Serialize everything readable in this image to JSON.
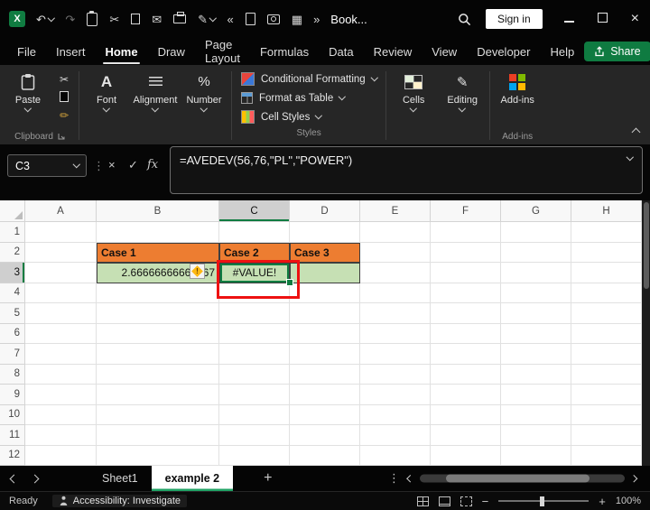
{
  "colors": {
    "accent_green": "#107C41",
    "share_green": "#0F7B41",
    "header_orange": "#ED7D31",
    "cell_green": "#C6E0B4",
    "annotation_red": "#EE1111",
    "active_sheet_underline": "#21A366"
  },
  "titlebar": {
    "logo_letter": "X",
    "title": "Book...",
    "sign_in_label": "Sign in",
    "overflow_glyph": "»",
    "close_glyph": "×",
    "quick_access": [
      {
        "name": "undo",
        "glyph": "↶",
        "caret": true
      },
      {
        "name": "redo",
        "glyph": "↷",
        "dim": true
      },
      {
        "name": "clipboard",
        "css": "clipboard"
      },
      {
        "name": "cut",
        "glyph": "✂"
      },
      {
        "name": "copy",
        "css": "copy"
      },
      {
        "name": "mail",
        "glyph": "✉"
      },
      {
        "name": "printer",
        "css": "printer"
      },
      {
        "name": "pen",
        "glyph": "✎",
        "caret": true
      },
      {
        "name": "collapse-toolbar",
        "glyph": "«"
      },
      {
        "name": "document",
        "css": "document"
      },
      {
        "name": "camera",
        "css": "camera"
      },
      {
        "name": "grid-view",
        "glyph": "▦"
      }
    ]
  },
  "menubar": {
    "tabs": [
      "File",
      "Insert",
      "Home",
      "Draw",
      "Page Layout",
      "Formulas",
      "Data",
      "Review",
      "View",
      "Developer",
      "Help"
    ],
    "active": "Home",
    "share_label": "Share"
  },
  "ribbon": {
    "paste_label": "Paste",
    "clipboard_group_label": "Clipboard",
    "font_label": "Font",
    "font_icon_letter": "A",
    "alignment_label": "Alignment",
    "number_label": "Number",
    "number_icon_glyph": "%",
    "styles_items": [
      "Conditional Formatting",
      "Format as Table",
      "Cell Styles"
    ],
    "styles_group_label": "Styles",
    "cells_label": "Cells",
    "editing_label": "Editing",
    "editing_icon_glyph": "✎",
    "addins_label": "Add-ins",
    "addins_group_label": "Add-ins"
  },
  "formula_bar": {
    "name_box": "C3",
    "separator_glyph": "⋮",
    "cancel_glyph": "×",
    "enter_glyph": "✓",
    "fx_label": "fx",
    "formula": "=AVEDEV(56,76,\"PL\",\"POWER\")"
  },
  "grid": {
    "column_headers": [
      "A",
      "B",
      "C",
      "D",
      "E",
      "F",
      "G",
      "H"
    ],
    "row_headers": [
      "1",
      "2",
      "3",
      "4",
      "5",
      "6",
      "7",
      "8",
      "9",
      "10",
      "11",
      "12"
    ],
    "selected_cell": "C3",
    "selected_column": "C",
    "selected_row": "3",
    "cells": {
      "B2": "Case 1",
      "C2": "Case 2",
      "D2": "Case 3",
      "B3": "2.66666666666667",
      "C3": "#VALUE!"
    },
    "orange_cells": [
      "B2",
      "C2",
      "D2"
    ],
    "green_cells": [
      "B3",
      "C3",
      "D3"
    ],
    "bold_cells": [
      "B2",
      "C2",
      "D2"
    ],
    "align": {
      "B3": "right",
      "C3": "center"
    }
  },
  "sheet_tabs": {
    "tabs": [
      {
        "label": "Sheet1",
        "active": false
      },
      {
        "label": "example 2",
        "active": true
      }
    ],
    "add_sheet_glyph": "+",
    "kebab_glyph": "⋮"
  },
  "status_bar": {
    "ready_label": "Ready",
    "accessibility_label": "Accessibility: Investigate",
    "zoom_out_glyph": "−",
    "zoom_in_glyph": "+",
    "zoom_value": "100%"
  }
}
